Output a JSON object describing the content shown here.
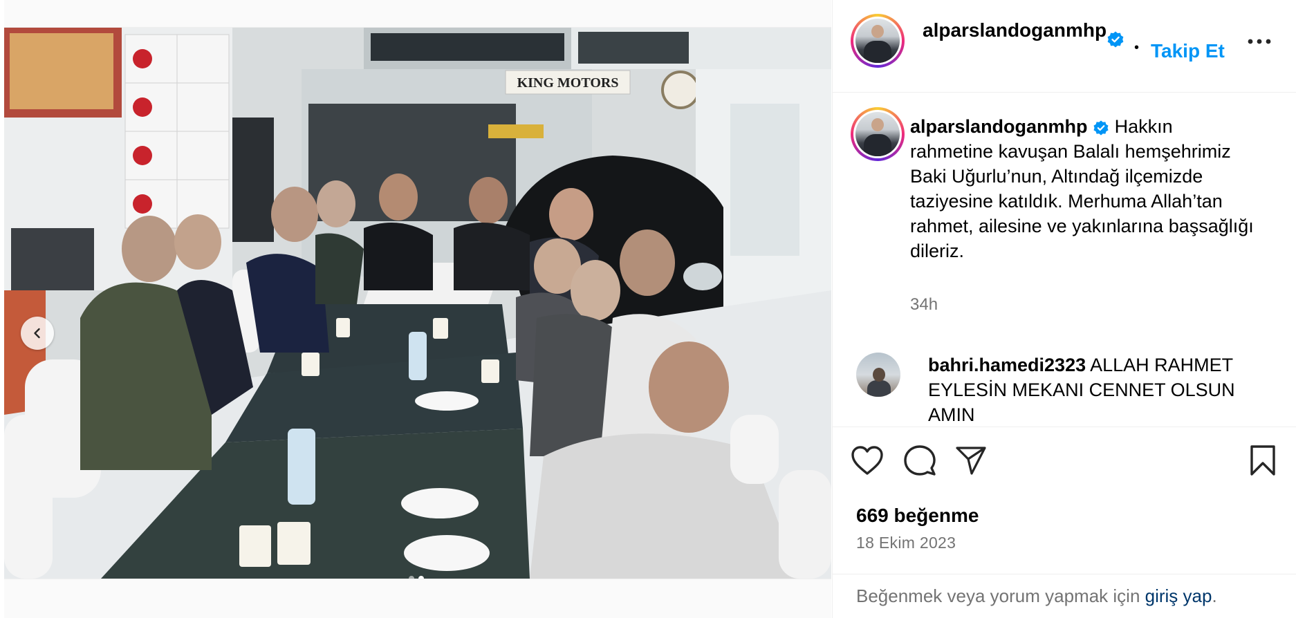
{
  "post": {
    "username": "alparslandoganmhp",
    "follow_label": "Takip Et",
    "separator": "•",
    "more_label": "...",
    "caption": "Hakkın rahmetine kavuşan Balalı hemşehrimiz Baki Uğurlu’nun, Altındağ ilçemizde taziyesine katıldık. Merhuma Allah’tan rahmet, ailesine ve yakınlarına başsağlığı dileriz.",
    "caption_time": "34h",
    "likes": "669 beğenme",
    "date": "18 Ekim 2023",
    "footer_prefix": "Beğenmek veya yorum yapmak için ",
    "footer_link": "giriş yap",
    "footer_suffix": "."
  },
  "comments": [
    {
      "username": "bahri.hamedi2323",
      "text": "ALLAH RAHMET EYLESİN MEKANI CENNET OLSUN AMIN"
    }
  ],
  "media": {
    "sign_text": "KING MOTORS",
    "current_slide": 2,
    "total_slides": 2
  },
  "icons": {
    "verified": "verified-badge-icon",
    "like": "heart-icon",
    "comment": "comment-icon",
    "share": "paper-plane-icon",
    "save": "bookmark-icon",
    "prev": "chevron-left-icon"
  },
  "colors": {
    "accent": "#0095f6",
    "verified": "#0095f6",
    "muted": "#737373",
    "link": "#00376b"
  }
}
